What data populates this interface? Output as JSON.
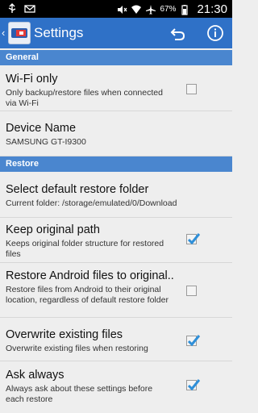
{
  "status_bar": {
    "battery": "67%",
    "time": "21:30"
  },
  "app": {
    "title": "Settings"
  },
  "sections": {
    "general": "General",
    "restore": "Restore"
  },
  "prefs": {
    "wifi_only": {
      "title": "Wi-Fi only",
      "summary": "Only backup/restore files when connected via Wi-Fi",
      "checked": false
    },
    "device_name": {
      "title": "Device Name",
      "summary": "SAMSUNG GT-I9300"
    },
    "default_folder": {
      "title": "Select default restore folder",
      "summary": "Current folder: /storage/emulated/0/Download"
    },
    "keep_path": {
      "title": "Keep original path",
      "summary": "Keeps original folder structure for restored files",
      "checked": true
    },
    "restore_android": {
      "title": "Restore Android files to original..",
      "summary": "Restore files from Android to their original location, regardless of default restore folder",
      "checked": false
    },
    "overwrite": {
      "title": "Overwrite existing files",
      "summary": "Overwrite existing files when restoring",
      "checked": true
    },
    "ask_always": {
      "title": "Ask always",
      "summary": "Always ask about these settings before each restore",
      "checked": true
    }
  },
  "colors": {
    "action_bar": "#2f71c7",
    "section_header": "#4a86cf",
    "check": "#2f8fd8"
  },
  "icons": [
    "usb-icon",
    "mail-icon",
    "mute-icon",
    "wifi-icon",
    "airplane-icon",
    "battery-icon",
    "undo-icon",
    "info-icon",
    "checkmark-icon"
  ]
}
